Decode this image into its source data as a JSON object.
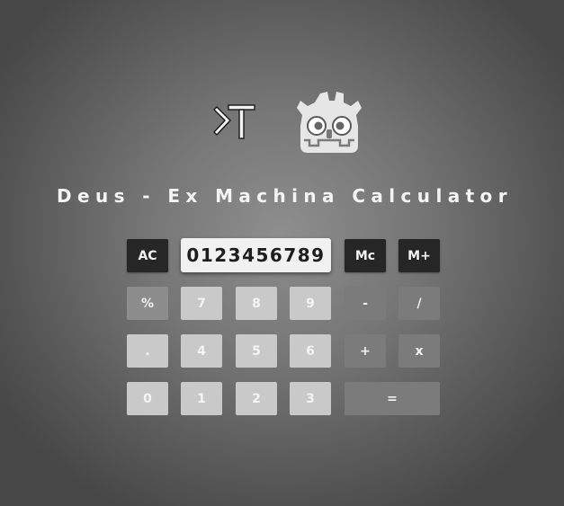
{
  "app": {
    "title": "Deus - Ex Machina Calculator",
    "logos": [
      "terminal-icon",
      "godot-icon"
    ]
  },
  "display": {
    "value": "0123456789"
  },
  "buttons": {
    "ac": "AC",
    "mc": "Mc",
    "mplus": "M+",
    "percent": "%",
    "seven": "7",
    "eight": "8",
    "nine": "9",
    "minus": "-",
    "divide": "/",
    "dot": ".",
    "four": "4",
    "five": "5",
    "six": "6",
    "plus": "+",
    "multiply": "x",
    "zero": "0",
    "one": "1",
    "two": "2",
    "three": "3",
    "equals": "="
  },
  "colors": {
    "background": "#7a7a7a",
    "dark_button": "#262626",
    "digit_button": "#c9c9c9",
    "operator_button": "#7b7b7b",
    "display_background": "#f1f1f1"
  }
}
